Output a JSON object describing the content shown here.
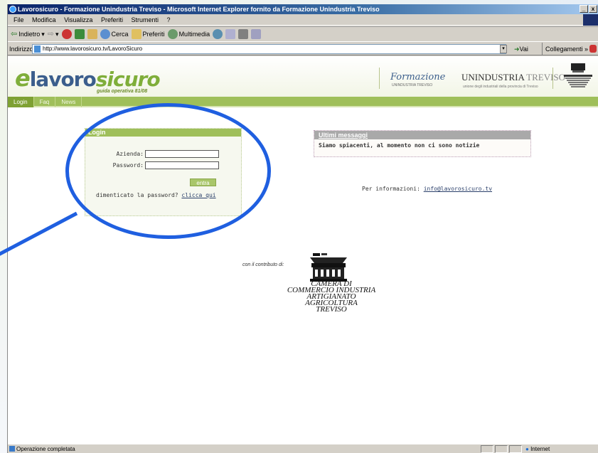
{
  "window": {
    "title": "Lavorosicuro - Formazione Unindustria Treviso - Microsoft Internet Explorer fornito da Formazione Unindustria Treviso",
    "minimize": "_",
    "close": "x"
  },
  "menu": [
    "File",
    "Modifica",
    "Visualizza",
    "Preferiti",
    "Strumenti",
    "?"
  ],
  "toolbar": {
    "back": "Indietro",
    "search": "Cerca",
    "favorites": "Preferiti",
    "multimedia": "Multimedia"
  },
  "address": {
    "label": "Indirizzo",
    "url": "http://www.lavorosicuro.tv/LavoroSicuro",
    "go": "Vai",
    "links": "Collegamenti"
  },
  "site": {
    "logo_e": "e",
    "logo_lavoro": "lavoro",
    "logo_sicuro": "sicuro",
    "logo_tagline": "guida operativa 81/08",
    "partner1": "Formazione",
    "partner1_sub": "UNINDUSTRIA TREVISO",
    "partner2_a": "UNINDUSTRIA",
    "partner2_b": " TREVISO",
    "partner2_sub": "unione degli industriali della provincia di Treviso",
    "nav": [
      "Login",
      "Faq",
      "News"
    ]
  },
  "login": {
    "header": "Login",
    "azienda_label": "Azienda:",
    "password_label": "Password:",
    "submit": "entra",
    "forgot_text": "dimenticato la password? ",
    "forgot_link": "clicca qui"
  },
  "messages": {
    "header": "Ultimi messaggi",
    "body": "Siamo spiacenti, al momento non ci sono notizie"
  },
  "info": {
    "text": "Per informazioni: ",
    "email": "info@lavorosicuro.tv"
  },
  "contrib": {
    "text": "con il contributo di:",
    "camera_lines": [
      "CAMERA DI",
      "COMMERCIO INDUSTRIA",
      "ARTIGIANATO",
      "AGRICOLTURA",
      "TREVISO"
    ]
  },
  "status": {
    "text": "Operazione completata",
    "zone": "Internet"
  }
}
